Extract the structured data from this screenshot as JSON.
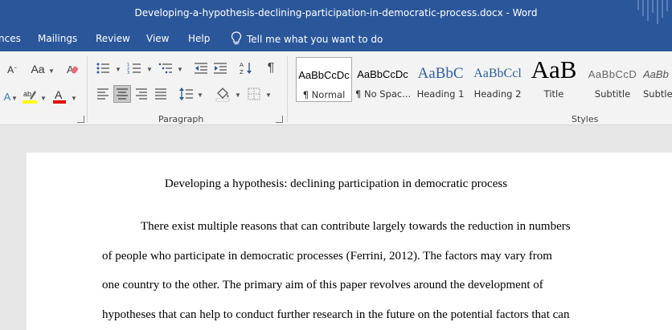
{
  "window": {
    "title": "Developing-a-hypothesis-declining-participation-in-democratic-process.docx  -  Word"
  },
  "menu": {
    "tabs": [
      "nces",
      "Mailings",
      "Review",
      "View",
      "Help"
    ],
    "tell_me": "Tell me what you want to do"
  },
  "ribbon": {
    "font_case_label": "Aa",
    "pilcrow": "¶",
    "paragraph_group_label": "Paragraph",
    "styles_group_label": "Styles",
    "styles": [
      {
        "sample": "AaBbCcDc",
        "name": "¶ Normal"
      },
      {
        "sample": "AaBbCcDc",
        "name": "¶ No Spac..."
      },
      {
        "sample": "AaBbC",
        "name": "Heading 1"
      },
      {
        "sample": "AaBbCcl",
        "name": "Heading 2"
      },
      {
        "sample": "AaB",
        "name": "Title"
      },
      {
        "sample": "AaBbCcD",
        "name": "Subtitle"
      },
      {
        "sample": "AaBb",
        "name": "Subtle"
      }
    ],
    "colors": {
      "highlight": "#ffff00",
      "font_color": "#e00000",
      "accent": "#2b579a"
    }
  },
  "document": {
    "title": "Developing a hypothesis: declining participation in democratic process",
    "lines": [
      "There exist multiple reasons that can contribute largely towards the reduction in numbers",
      "of people who participate in democratic processes (Ferrini, 2012). The factors may vary from",
      "one country to the other. The primary aim of this paper revolves around the development of",
      "hypotheses that can help to conduct further research in the future on the potential factors that can"
    ]
  }
}
